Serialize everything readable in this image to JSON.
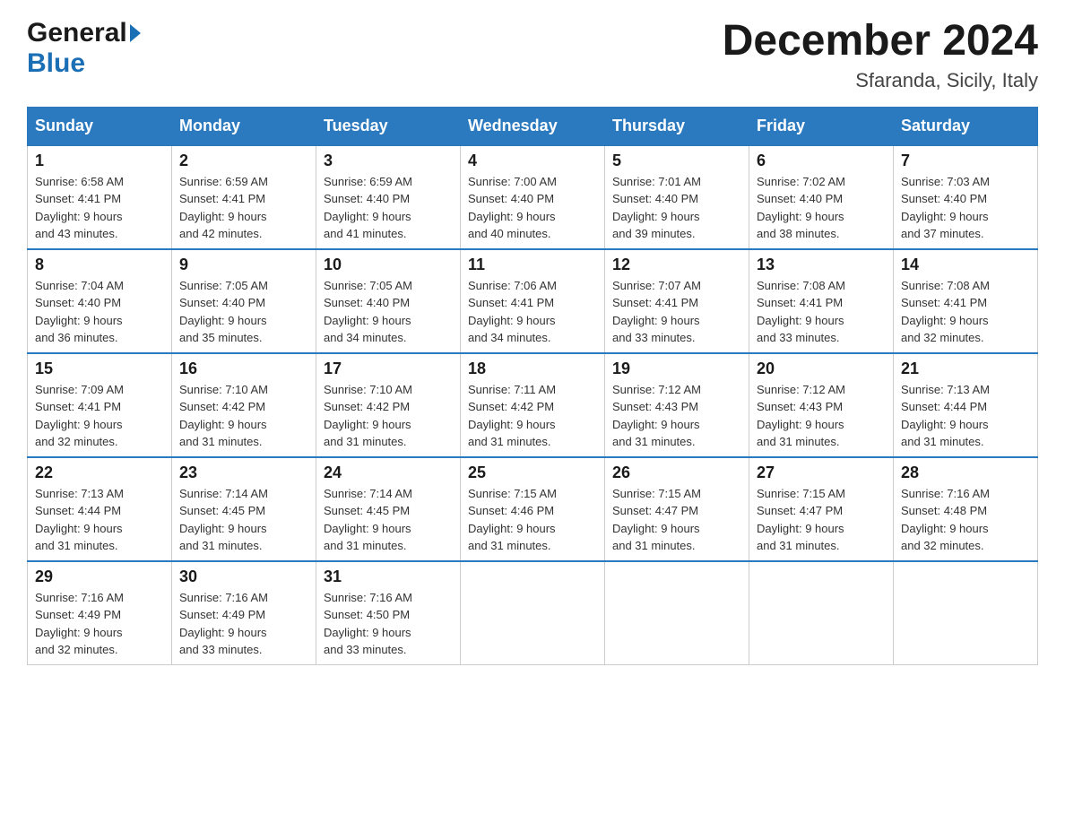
{
  "header": {
    "logo_general": "General",
    "logo_blue": "Blue",
    "month_year": "December 2024",
    "location": "Sfaranda, Sicily, Italy"
  },
  "days_of_week": [
    "Sunday",
    "Monday",
    "Tuesday",
    "Wednesday",
    "Thursday",
    "Friday",
    "Saturday"
  ],
  "weeks": [
    [
      {
        "num": "1",
        "sunrise": "6:58 AM",
        "sunset": "4:41 PM",
        "daylight": "9 hours and 43 minutes."
      },
      {
        "num": "2",
        "sunrise": "6:59 AM",
        "sunset": "4:41 PM",
        "daylight": "9 hours and 42 minutes."
      },
      {
        "num": "3",
        "sunrise": "6:59 AM",
        "sunset": "4:40 PM",
        "daylight": "9 hours and 41 minutes."
      },
      {
        "num": "4",
        "sunrise": "7:00 AM",
        "sunset": "4:40 PM",
        "daylight": "9 hours and 40 minutes."
      },
      {
        "num": "5",
        "sunrise": "7:01 AM",
        "sunset": "4:40 PM",
        "daylight": "9 hours and 39 minutes."
      },
      {
        "num": "6",
        "sunrise": "7:02 AM",
        "sunset": "4:40 PM",
        "daylight": "9 hours and 38 minutes."
      },
      {
        "num": "7",
        "sunrise": "7:03 AM",
        "sunset": "4:40 PM",
        "daylight": "9 hours and 37 minutes."
      }
    ],
    [
      {
        "num": "8",
        "sunrise": "7:04 AM",
        "sunset": "4:40 PM",
        "daylight": "9 hours and 36 minutes."
      },
      {
        "num": "9",
        "sunrise": "7:05 AM",
        "sunset": "4:40 PM",
        "daylight": "9 hours and 35 minutes."
      },
      {
        "num": "10",
        "sunrise": "7:05 AM",
        "sunset": "4:40 PM",
        "daylight": "9 hours and 34 minutes."
      },
      {
        "num": "11",
        "sunrise": "7:06 AM",
        "sunset": "4:41 PM",
        "daylight": "9 hours and 34 minutes."
      },
      {
        "num": "12",
        "sunrise": "7:07 AM",
        "sunset": "4:41 PM",
        "daylight": "9 hours and 33 minutes."
      },
      {
        "num": "13",
        "sunrise": "7:08 AM",
        "sunset": "4:41 PM",
        "daylight": "9 hours and 33 minutes."
      },
      {
        "num": "14",
        "sunrise": "7:08 AM",
        "sunset": "4:41 PM",
        "daylight": "9 hours and 32 minutes."
      }
    ],
    [
      {
        "num": "15",
        "sunrise": "7:09 AM",
        "sunset": "4:41 PM",
        "daylight": "9 hours and 32 minutes."
      },
      {
        "num": "16",
        "sunrise": "7:10 AM",
        "sunset": "4:42 PM",
        "daylight": "9 hours and 31 minutes."
      },
      {
        "num": "17",
        "sunrise": "7:10 AM",
        "sunset": "4:42 PM",
        "daylight": "9 hours and 31 minutes."
      },
      {
        "num": "18",
        "sunrise": "7:11 AM",
        "sunset": "4:42 PM",
        "daylight": "9 hours and 31 minutes."
      },
      {
        "num": "19",
        "sunrise": "7:12 AM",
        "sunset": "4:43 PM",
        "daylight": "9 hours and 31 minutes."
      },
      {
        "num": "20",
        "sunrise": "7:12 AM",
        "sunset": "4:43 PM",
        "daylight": "9 hours and 31 minutes."
      },
      {
        "num": "21",
        "sunrise": "7:13 AM",
        "sunset": "4:44 PM",
        "daylight": "9 hours and 31 minutes."
      }
    ],
    [
      {
        "num": "22",
        "sunrise": "7:13 AM",
        "sunset": "4:44 PM",
        "daylight": "9 hours and 31 minutes."
      },
      {
        "num": "23",
        "sunrise": "7:14 AM",
        "sunset": "4:45 PM",
        "daylight": "9 hours and 31 minutes."
      },
      {
        "num": "24",
        "sunrise": "7:14 AM",
        "sunset": "4:45 PM",
        "daylight": "9 hours and 31 minutes."
      },
      {
        "num": "25",
        "sunrise": "7:15 AM",
        "sunset": "4:46 PM",
        "daylight": "9 hours and 31 minutes."
      },
      {
        "num": "26",
        "sunrise": "7:15 AM",
        "sunset": "4:47 PM",
        "daylight": "9 hours and 31 minutes."
      },
      {
        "num": "27",
        "sunrise": "7:15 AM",
        "sunset": "4:47 PM",
        "daylight": "9 hours and 31 minutes."
      },
      {
        "num": "28",
        "sunrise": "7:16 AM",
        "sunset": "4:48 PM",
        "daylight": "9 hours and 32 minutes."
      }
    ],
    [
      {
        "num": "29",
        "sunrise": "7:16 AM",
        "sunset": "4:49 PM",
        "daylight": "9 hours and 32 minutes."
      },
      {
        "num": "30",
        "sunrise": "7:16 AM",
        "sunset": "4:49 PM",
        "daylight": "9 hours and 33 minutes."
      },
      {
        "num": "31",
        "sunrise": "7:16 AM",
        "sunset": "4:50 PM",
        "daylight": "9 hours and 33 minutes."
      },
      null,
      null,
      null,
      null
    ]
  ],
  "labels": {
    "sunrise": "Sunrise:",
    "sunset": "Sunset:",
    "daylight": "Daylight:"
  }
}
